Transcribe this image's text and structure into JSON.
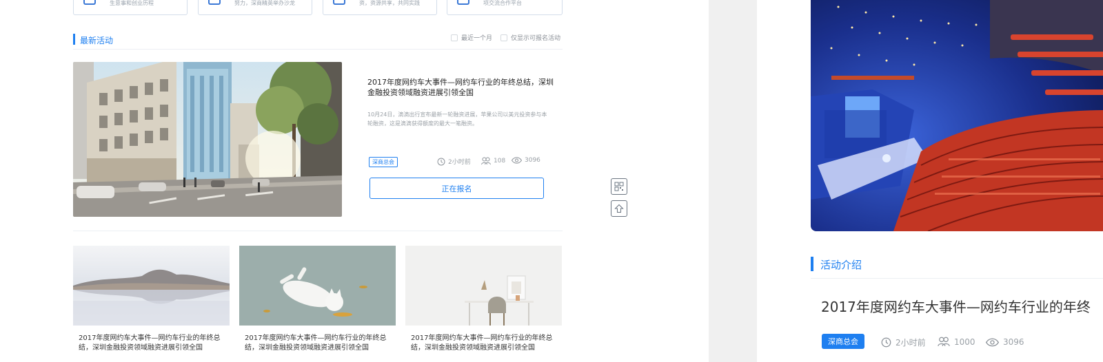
{
  "categories": [
    {
      "text": "生意事和创业历程",
      "icon": "briefcase-icon"
    },
    {
      "text": "努力，深商精英举办沙龙",
      "icon": "people-icon"
    },
    {
      "text": "资，资源共享，共同实践",
      "icon": "handshake-icon"
    },
    {
      "text": "项交流合作平台",
      "icon": "truck-icon"
    }
  ],
  "section": {
    "title": "最新活动",
    "filter_recent": "最近一个月",
    "filter_open": "仅显示可报名活动"
  },
  "feature": {
    "title": "2017年度网约车大事件—网约车行业的年终总结，深圳金融投资领域融资进展引领全国",
    "desc": "10月24日，滴滴出行宣布最新一轮融资进展，苹果公司以美元投资参与本轮融资，这是滴滴获得额度的最大一笔融资。",
    "tag": "深商总会",
    "time": "2小时前",
    "members": "108",
    "views": "3096",
    "button": "正在报名"
  },
  "cards": [
    {
      "title": "2017年度网约车大事件—网约车行业的年终总结，深圳金融投资领域融资进展引领全国"
    },
    {
      "title": "2017年度网约车大事件—网约车行业的年终总结，深圳金融投资领域融资进展引领全国"
    },
    {
      "title": "2017年度网约车大事件—网约车行业的年终总结，深圳金融投资领域融资进展引领全国"
    }
  ],
  "detail": {
    "section_title": "活动介绍",
    "title": "2017年度网约车大事件—网约车行业的年终",
    "tag": "深商总会",
    "time": "2小时前",
    "members": "1000",
    "views": "3096"
  },
  "colors": {
    "accent": "#1e7ff0",
    "border": "#d3ddea",
    "muted": "#9aa0a6",
    "gap": "#f0f0f0"
  }
}
